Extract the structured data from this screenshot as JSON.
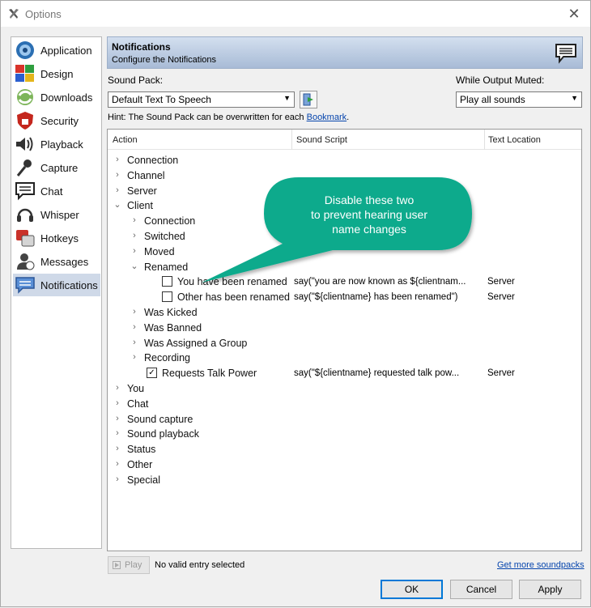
{
  "window": {
    "title": "Options",
    "close_glyph": "✕"
  },
  "sidebar": {
    "items": [
      {
        "label": "Application",
        "icon": "speaker-icon"
      },
      {
        "label": "Design",
        "icon": "palette-icon"
      },
      {
        "label": "Downloads",
        "icon": "download-icon"
      },
      {
        "label": "Security",
        "icon": "shield-icon"
      },
      {
        "label": "Playback",
        "icon": "playback-speaker-icon"
      },
      {
        "label": "Capture",
        "icon": "microphone-icon"
      },
      {
        "label": "Chat",
        "icon": "chat-icon"
      },
      {
        "label": "Whisper",
        "icon": "headset-icon"
      },
      {
        "label": "Hotkeys",
        "icon": "hotkeys-icon"
      },
      {
        "label": "Messages",
        "icon": "messages-icon"
      },
      {
        "label": "Notifications",
        "icon": "notifications-icon",
        "active": true
      }
    ]
  },
  "header": {
    "title": "Notifications",
    "subtitle": "Configure the Notifications"
  },
  "sound_pack": {
    "label": "Sound Pack:",
    "value": "Default Text To Speech"
  },
  "muted": {
    "label": "While Output Muted:",
    "value": "Play all sounds"
  },
  "hint": {
    "text": "Hint: The Sound Pack can be overwritten for each ",
    "link": "Bookmark",
    "suffix": "."
  },
  "tree": {
    "columns": [
      "Action",
      "Sound Script",
      "Text Location"
    ],
    "rows": [
      {
        "label": "Connection",
        "chevron": "›",
        "level": 0
      },
      {
        "label": "Channel",
        "chevron": "›",
        "level": 0
      },
      {
        "label": "Server",
        "chevron": "›",
        "level": 0
      },
      {
        "label": "Client",
        "chevron": "⌄",
        "level": 0
      },
      {
        "label": "Connection",
        "chevron": "›",
        "level": 1
      },
      {
        "label": "Switched",
        "chevron": "›",
        "level": 1
      },
      {
        "label": "Moved",
        "chevron": "›",
        "level": 1
      },
      {
        "label": "Renamed",
        "chevron": "⌄",
        "level": 1
      },
      {
        "label": "You have been renamed",
        "checkbox": "",
        "level": 2,
        "script": "say(\"you are now known as ${clientnam...",
        "location": "Server"
      },
      {
        "label": "Other has been renamed",
        "checkbox": "",
        "level": 2,
        "script": "say(\"${clientname} has been renamed\")",
        "location": "Server"
      },
      {
        "label": "Was Kicked",
        "chevron": "›",
        "level": 1
      },
      {
        "label": "Was Banned",
        "chevron": "›",
        "level": 1
      },
      {
        "label": "Was Assigned a Group",
        "chevron": "›",
        "level": 1
      },
      {
        "label": "Recording",
        "chevron": "›",
        "level": 1
      },
      {
        "label": "Requests Talk Power",
        "checkbox": "✓",
        "level": 1,
        "script": "say(\"${clientname} requested talk pow...",
        "location": "Server"
      },
      {
        "label": "You",
        "chevron": "›",
        "level": 0
      },
      {
        "label": "Chat",
        "chevron": "›",
        "level": 0
      },
      {
        "label": "Sound capture",
        "chevron": "›",
        "level": 0
      },
      {
        "label": "Sound playback",
        "chevron": "›",
        "level": 0
      },
      {
        "label": "Status",
        "chevron": "›",
        "level": 0
      },
      {
        "label": "Other",
        "chevron": "›",
        "level": 0
      },
      {
        "label": "Special",
        "chevron": "›",
        "level": 0
      }
    ]
  },
  "footer": {
    "play_label": "Play",
    "status": "No valid entry selected",
    "more_link": "Get more soundpacks",
    "ok": "OK",
    "cancel": "Cancel",
    "apply": "Apply"
  },
  "callout": {
    "lines": [
      "Disable these two",
      "to prevent hearing user",
      "name changes"
    ],
    "color": "#0aaa8c"
  }
}
